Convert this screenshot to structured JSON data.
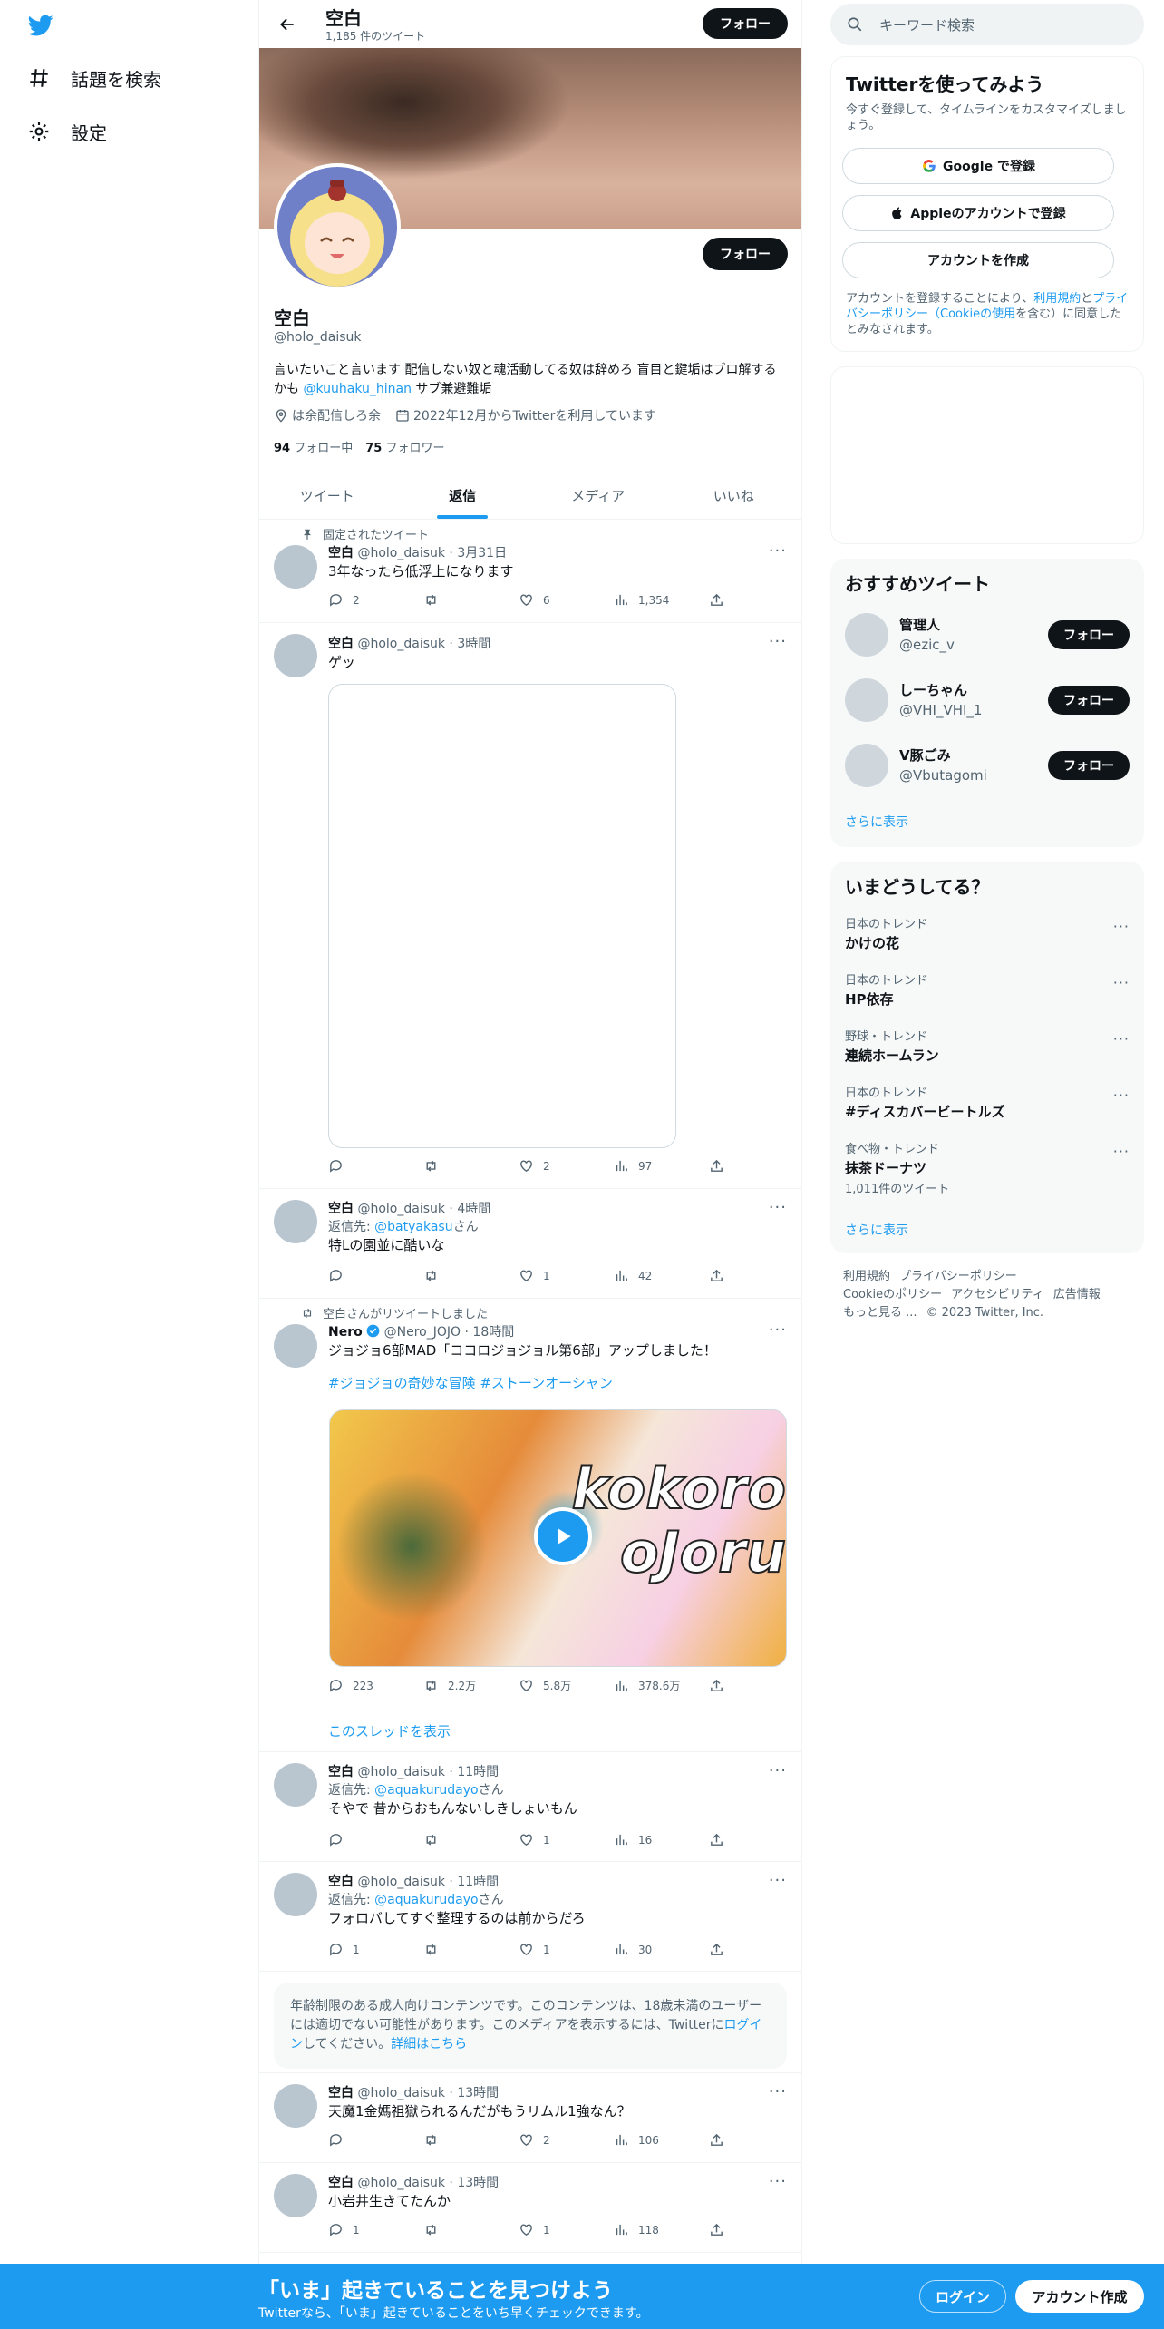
{
  "nav": {
    "explore_label": "話題を検索",
    "settings_label": "設定"
  },
  "header": {
    "name": "空白",
    "tweet_count": "1,185 件のツイート",
    "follow_label": "フォロー"
  },
  "profile": {
    "name": "空白",
    "handle": "@holo_daisuk",
    "follow_label": "フォロー",
    "bio_prefix": "言いたいこと言います 配信しない奴と魂活動してる奴は辞めろ 盲目と鍵垢はブロ解するかも ",
    "bio_link": "@kuuhaku_hinan",
    "bio_suffix": " サブ兼避難垢",
    "location": "は余配信しろ余",
    "joined": "2022年12月からTwitterを利用しています",
    "following_count": "94",
    "following_label": "フォロー中",
    "followers_count": "75",
    "followers_label": "フォロワー"
  },
  "tabs": [
    "ツイート",
    "返信",
    "メディア",
    "いいね"
  ],
  "tweets": {
    "t1": {
      "pinned_label": "固定されたツイート",
      "name": "空白",
      "handle": "@holo_daisuk",
      "time": "3月31日",
      "text": "3年なったら低浮上になります",
      "replies": "2",
      "retweets": "",
      "likes": "6",
      "views": "1,354"
    },
    "t2": {
      "name": "空白",
      "handle": "@holo_daisuk",
      "time": "3時間",
      "text": "ゲッ",
      "replies": "",
      "retweets": "",
      "likes": "2",
      "views": "97"
    },
    "t3": {
      "name": "空白",
      "handle": "@holo_daisuk",
      "time": "4時間",
      "reply_prefix": "返信先: ",
      "reply_to": "@batyakasu",
      "reply_suffix": "さん",
      "text": "特Lの園並に酷いな",
      "replies": "",
      "retweets": "",
      "likes": "1",
      "views": "42"
    },
    "t4": {
      "retweet_label": "空白さんがリツイートしました",
      "name": "Nero",
      "handle": "@Nero_JOJO",
      "time": "18時間",
      "text": "ジョジョ6部MAD「ココロジョジョル第6部」アップしました！",
      "hashtags": "#ジョジョの奇妙な冒険 #ストーンオーシャン",
      "video_word1": "kokoro",
      "video_word2": "oJoru",
      "replies": "223",
      "retweets": "2.2万",
      "likes": "5.8万",
      "views": "378.6万",
      "thread_link": "このスレッドを表示"
    },
    "t5": {
      "name": "空白",
      "handle": "@holo_daisuk",
      "time": "11時間",
      "reply_prefix": "返信先: ",
      "reply_to": "@aquakurudayo",
      "reply_suffix": "さん",
      "text": "そやで 昔からおもんないしきしょいもん",
      "replies": "",
      "retweets": "",
      "likes": "1",
      "views": "16"
    },
    "t6": {
      "name": "空白",
      "handle": "@holo_daisuk",
      "time": "11時間",
      "reply_prefix": "返信先: ",
      "reply_to": "@aquakurudayo",
      "reply_suffix": "さん",
      "text": "フォロバしてすぐ整理するのは前からだろ",
      "replies": "1",
      "retweets": "",
      "likes": "1",
      "views": "30"
    },
    "notice": {
      "text1": "年齢制限のある成人向けコンテンツです。このコンテンツは、18歳未満のユーザーには適切でない可能性があります。このメディアを表示するには、Twitterに",
      "login_link": "ログイン",
      "text2": "してください。",
      "details_link": "詳細はこちら"
    },
    "t7": {
      "name": "空白",
      "handle": "@holo_daisuk",
      "time": "13時間",
      "text": "天魔1金媽祖獄られるんだがもうリムル1強なん？",
      "replies": "",
      "retweets": "",
      "likes": "2",
      "views": "106"
    },
    "t8": {
      "name": "空白",
      "handle": "@holo_daisuk",
      "time": "13時間",
      "text": "小岩井生きてたんか",
      "replies": "1",
      "retweets": "",
      "likes": "1",
      "views": "118"
    }
  },
  "sidebar": {
    "search_placeholder": "キーワード検索",
    "signup": {
      "title": "Twitterを使ってみよう",
      "subtitle": "今すぐ登録して、タイムラインをカスタマイズしましょう。",
      "google_label": "Google で登録",
      "apple_label": "Appleのアカウントで登録",
      "create_label": "アカウントを作成",
      "terms_prefix": "アカウントを登録することにより、",
      "terms_link": "利用規約",
      "terms_and": "と",
      "privacy_link": "プライバシーポリシー（Cookieの使用",
      "terms_suffix": "を含む）に同意したとみなされます。"
    },
    "recommended": {
      "title": "おすすめツイート",
      "users": [
        {
          "name": "管理人",
          "handle": "@ezic_v",
          "button": "フォロー"
        },
        {
          "name": "しーちゃん",
          "handle": "@VHI_VHI_1",
          "button": "フォロー"
        },
        {
          "name": "V豚ごみ",
          "handle": "@Vbutagomi",
          "button": "フォロー"
        }
      ],
      "more": "さらに表示"
    },
    "trends": {
      "title": "いまどうしてる？",
      "items": [
        {
          "context": "日本のトレンド",
          "name": "かけの花",
          "count": ""
        },
        {
          "context": "日本のトレンド",
          "name": "HP依存",
          "count": ""
        },
        {
          "context": "野球・トレンド",
          "name": "連続ホームラン",
          "count": ""
        },
        {
          "context": "日本のトレンド",
          "name": "#ディスカバービートルズ",
          "count": ""
        },
        {
          "context": "食べ物・トレンド",
          "name": "抹茶ドーナツ",
          "count": "1,011件のツイート"
        }
      ],
      "more": "さらに表示"
    },
    "footer": {
      "terms": "利用規約",
      "privacy": "プライバシーポリシー",
      "cookie": "Cookieのポリシー",
      "accessibility": "アクセシビリティ",
      "ads": "広告情報",
      "more": "もっと見る ...",
      "copyright": "© 2023 Twitter, Inc."
    }
  },
  "bottom_bar": {
    "title": "「いま」起きていることを見つけよう",
    "subtitle": "Twitterなら、「いま」起きていることをいち早くチェックできます。",
    "login_label": "ログイン",
    "signup_label": "アカウント作成"
  },
  "colors": {
    "accent": "#1d9bf0",
    "text": "#0f1419",
    "muted": "#536471"
  }
}
